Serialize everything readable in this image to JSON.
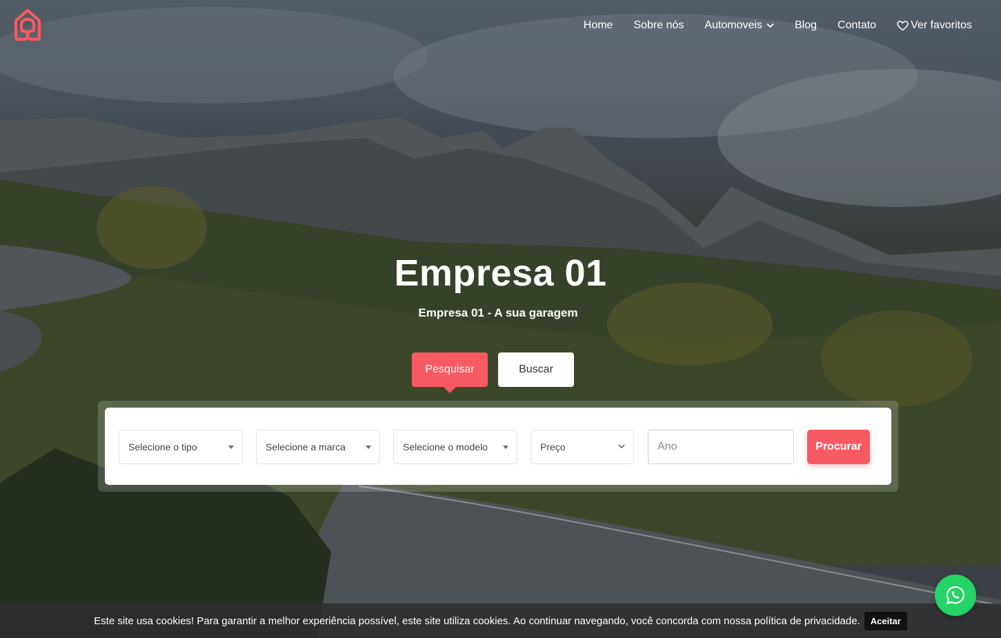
{
  "nav": {
    "items": [
      {
        "label": "Home"
      },
      {
        "label": "Sobre nós"
      },
      {
        "label": "Automoveis"
      },
      {
        "label": "Blog"
      },
      {
        "label": "Contato"
      },
      {
        "label": "Ver favoritos"
      }
    ]
  },
  "hero": {
    "title": "Empresa 01",
    "subtitle": "Empresa 01 - A sua garagem"
  },
  "tabs": [
    {
      "label": "Pesquisar",
      "active": true
    },
    {
      "label": "Buscar",
      "active": false
    }
  ],
  "search": {
    "tipo": "Selecione o tipo",
    "marca": "Selecione a marca",
    "modelo": "Selecione o modelo",
    "preco": "Preço",
    "ano_placeholder": "Ano",
    "submit": "Procurar"
  },
  "cookie": {
    "text": "Este site usa cookies! Para garantir a melhor experiência possível, este site utiliza cookies. Ao continuar navegando, você concorda com nossa política de privacidade.",
    "button": "Aceitar"
  },
  "icons": {
    "logo": "home-logo-icon",
    "favorites": "heart-icon",
    "dropdown": "chevron-down-icon",
    "whatsapp": "whatsapp-icon"
  },
  "colors": {
    "accent": "#f85a63",
    "whatsapp": "#25d366"
  }
}
